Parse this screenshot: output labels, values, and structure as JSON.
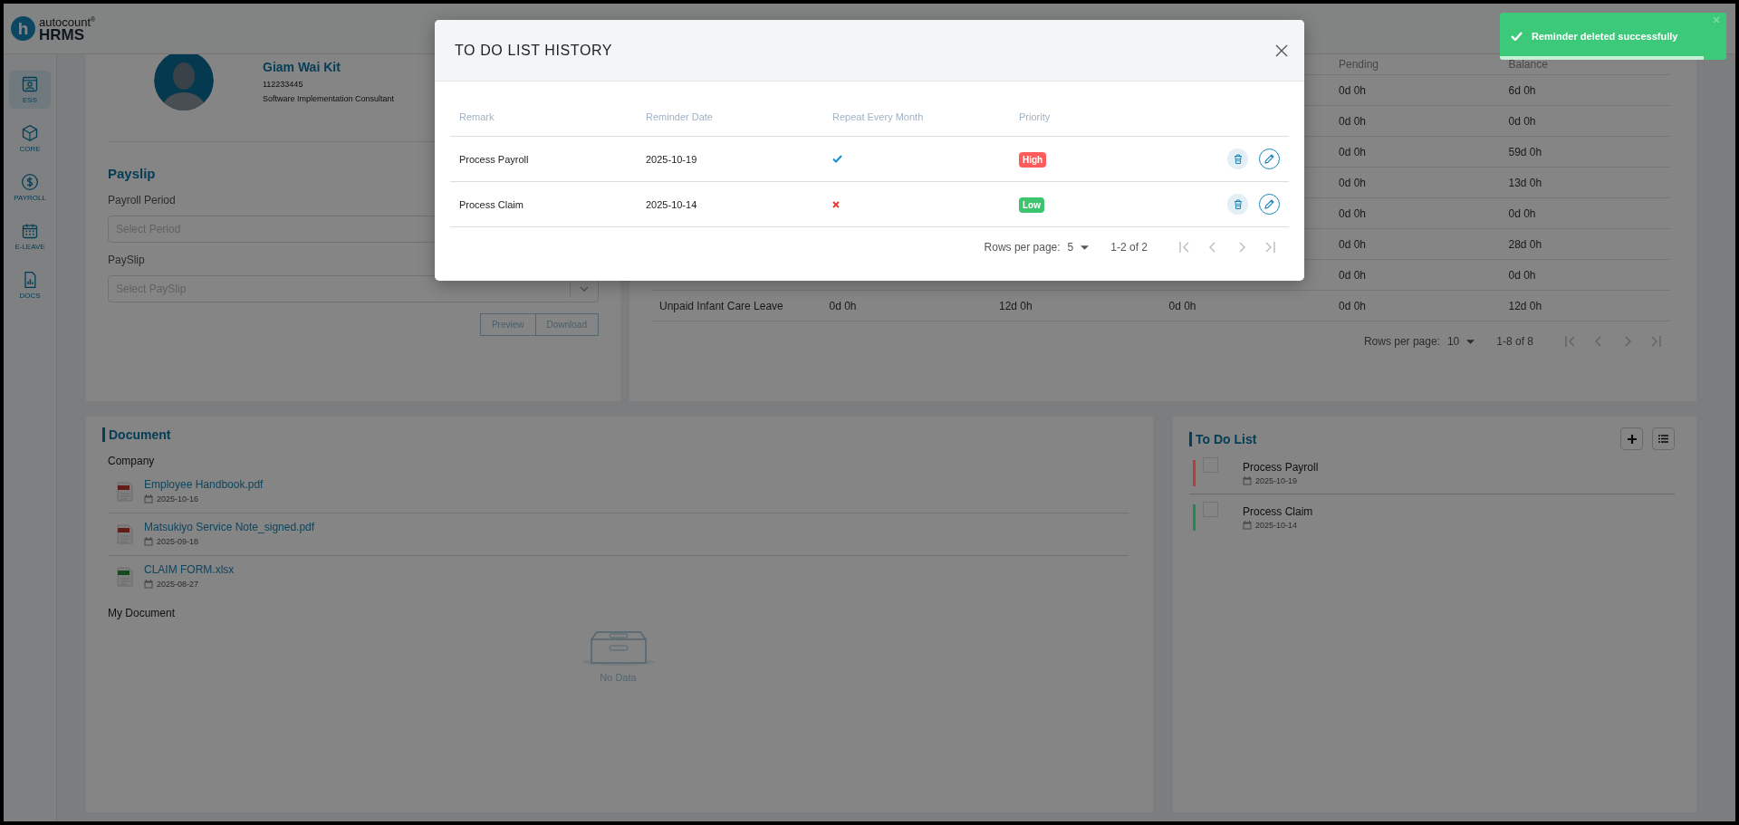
{
  "app": {
    "logo_mark": "h",
    "logo_top": "autocount$^{®}$",
    "logo_bottom": "HRMS"
  },
  "sidebar": {
    "items": [
      {
        "label": "ESS",
        "selected": true
      },
      {
        "label": "CORE",
        "selected": false
      },
      {
        "label": "PAYROLL",
        "selected": false
      },
      {
        "label": "E-LEAVE",
        "selected": false
      },
      {
        "label": "DOCS",
        "selected": false
      }
    ]
  },
  "profile": {
    "name": "Giam Wai Kit",
    "id": "112233445",
    "position": "Software Implementation Consultant"
  },
  "payslip": {
    "title": "Payslip",
    "fields": [
      {
        "label": "Payroll Period",
        "placeholder": "Select Period"
      },
      {
        "label": "PaySlip",
        "placeholder": "Select PaySlip"
      }
    ],
    "buttons": [
      "Preview",
      "Download"
    ]
  },
  "leave_balance": {
    "headers": {
      "pending": "Pending",
      "balance": "Balance"
    },
    "rows": [
      {
        "pending": "0d 0h",
        "balance": "6d 0h"
      },
      {
        "pending": "0d 0h",
        "balance": "0d 0h"
      },
      {
        "pending": "0d 0h",
        "balance": "59d 0h"
      },
      {
        "pending": "0d 0h",
        "balance": "13d 0h"
      },
      {
        "pending": "0d 0h",
        "balance": "0d 0h"
      },
      {
        "pending": "0d 0h",
        "balance": "28d 0h"
      },
      {
        "pending": "0d 0h",
        "balance": "0d 0h"
      },
      {
        "column_1": "Unpaid Infant Care Leave",
        "column_2": "0d 0h",
        "column_3": "12d 0h",
        "column_4": "0d 0h",
        "pending": "0d 0h",
        "balance": "12d 0h"
      }
    ],
    "pagination": {
      "label": "Rows per page:",
      "rows_per_page": "10",
      "range": "1-8 of 8"
    }
  },
  "documents": {
    "title": "Document",
    "sections": [
      {
        "title": "Company",
        "files": [
          {
            "name": "Employee Handbook.pdf",
            "date": "2025-10-16",
            "kind": "pdf"
          },
          {
            "name": "Matsukiyo Service Note_signed.pdf",
            "date": "2025-09-18",
            "kind": "pdf"
          },
          {
            "name": "CLAIM FORM.xlsx",
            "date": "2025-08-27",
            "kind": "xlsx"
          }
        ]
      },
      {
        "title": "My Document",
        "empty_text": "No Data"
      }
    ]
  },
  "todo": {
    "title": "To Do List",
    "items": [
      {
        "title": "Process Payroll",
        "date": "2025-10-19",
        "color": "#b83c3c",
        "checked": false
      },
      {
        "title": "Process Claim",
        "date": "2025-10-14",
        "color": "#1e8c4a",
        "checked": false
      }
    ]
  },
  "modal": {
    "title": "TO DO LIST HISTORY",
    "columns": [
      "Remark",
      "Reminder Date",
      "Repeat Every Month",
      "Priority"
    ],
    "rows": [
      {
        "remark": "Process Payroll",
        "date": "2025-10-19",
        "repeat": true,
        "priority": "High",
        "color": "#ff5b5b"
      },
      {
        "remark": "Process Claim",
        "date": "2025-10-14",
        "repeat": false,
        "priority": "Low",
        "color": "#3cc46e"
      }
    ],
    "pagination": {
      "label": "Rows per page:",
      "rows_per_page": "5",
      "range": "1-2 of 2"
    }
  },
  "toast": {
    "message": "Reminder deleted successfully",
    "level": 0.9
  }
}
